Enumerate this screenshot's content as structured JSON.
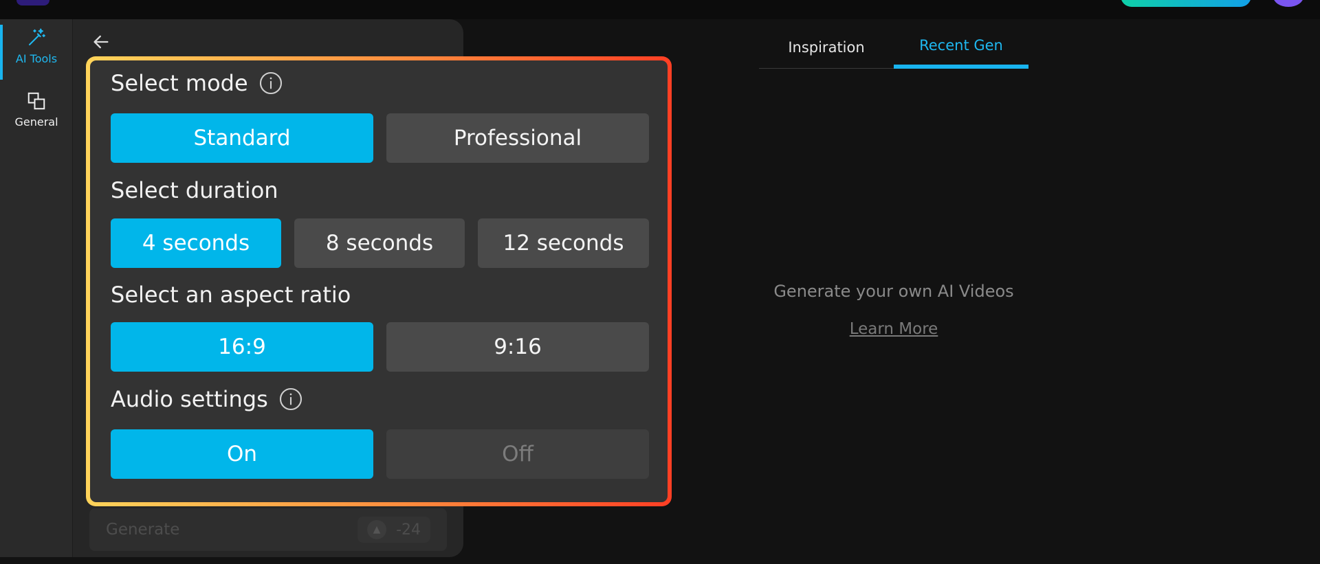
{
  "sidebar": {
    "items": [
      {
        "label": "AI Tools",
        "icon": "magic-wand-icon",
        "active": true
      },
      {
        "label": "General",
        "icon": "copy-squares-icon",
        "active": false
      }
    ]
  },
  "settings": {
    "mode": {
      "title": "Select mode",
      "options": [
        "Standard",
        "Professional"
      ],
      "selected": "Standard"
    },
    "duration": {
      "title": "Select duration",
      "options": [
        "4 seconds",
        "8 seconds",
        "12 seconds"
      ],
      "selected": "4 seconds"
    },
    "aspect": {
      "title": "Select an aspect ratio",
      "options": [
        "16:9",
        "9:16"
      ],
      "selected": "16:9"
    },
    "audio": {
      "title": "Audio settings",
      "options": [
        "On",
        "Off"
      ],
      "selected": "On"
    }
  },
  "generate": {
    "label": "Generate",
    "cost": "-24"
  },
  "tabs": [
    {
      "label": "Inspiration",
      "active": false
    },
    {
      "label": "Recent Gen",
      "active": true
    }
  ],
  "empty_state": {
    "message": "Generate your own AI Videos",
    "link": "Learn More"
  },
  "colors": {
    "accent": "#01b6ea",
    "panel": "#333333",
    "border_gradient": [
      "#ffd45a",
      "#ff8b3d",
      "#ff3f24"
    ]
  }
}
